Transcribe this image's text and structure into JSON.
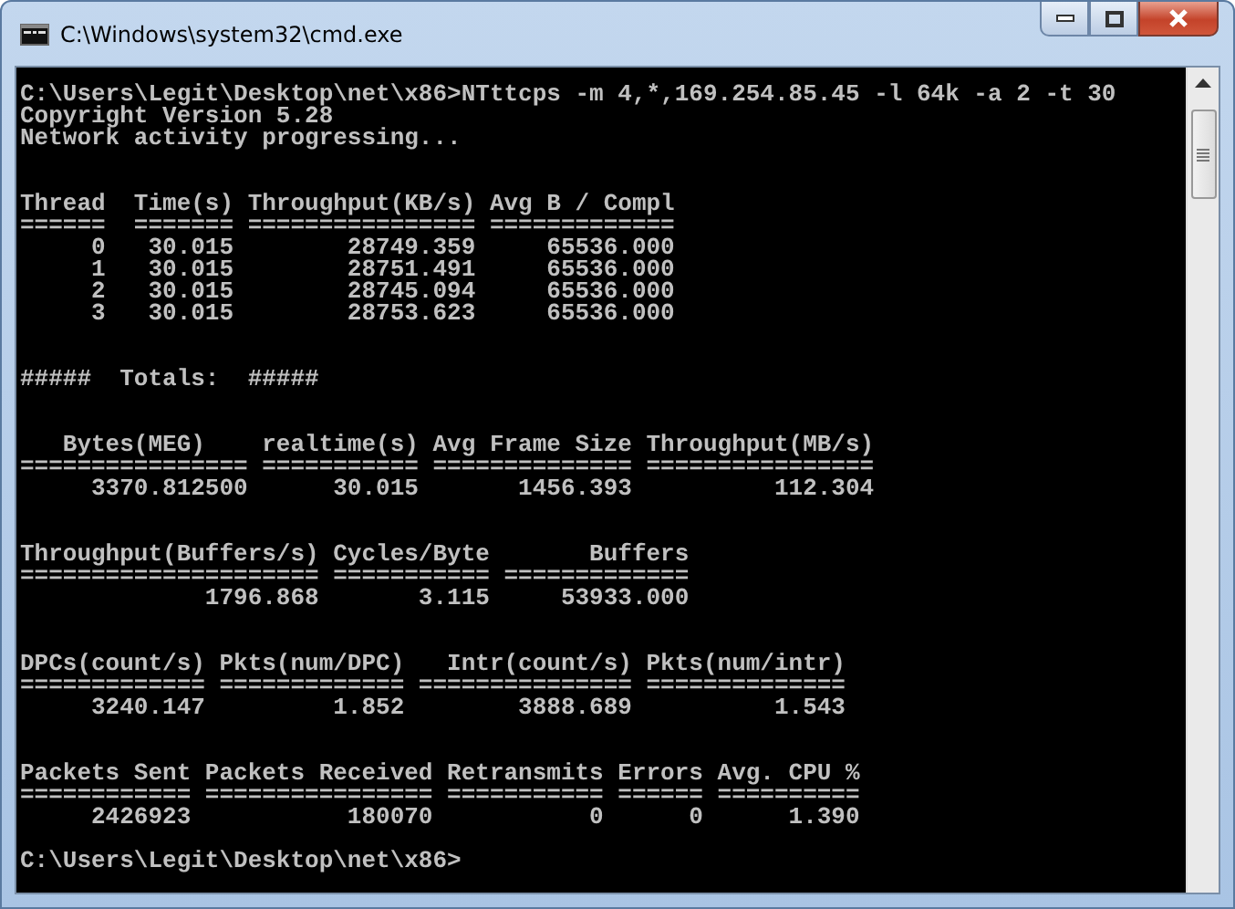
{
  "window": {
    "title": "C:\\Windows\\system32\\cmd.exe"
  },
  "console": {
    "blocks": [
      {
        "kind": "output",
        "lines": [
          "C:\\Users\\Legit\\Desktop\\net\\x86>NTttcps -m 4,*,169.254.85.45 -l 64k -a 2 -t 30",
          "Copyright Version 5.28",
          "Network activity progressing..."
        ]
      },
      {
        "kind": "output",
        "lines": [
          "Thread  Time(s) Throughput(KB/s) Avg B / Compl",
          "======  ======= ================ =============",
          "     0   30.015        28749.359     65536.000",
          "     1   30.015        28751.491     65536.000",
          "     2   30.015        28745.094     65536.000",
          "     3   30.015        28753.623     65536.000"
        ]
      },
      {
        "kind": "output",
        "lines": [
          "#####  Totals:  #####"
        ]
      },
      {
        "kind": "output",
        "lines": [
          "   Bytes(MEG)    realtime(s) Avg Frame Size Throughput(MB/s)",
          "================ =========== ============== ================",
          "     3370.812500      30.015       1456.393          112.304"
        ]
      },
      {
        "kind": "output",
        "lines": [
          "Throughput(Buffers/s) Cycles/Byte       Buffers",
          "===================== =========== =============",
          "             1796.868       3.115     53933.000"
        ]
      },
      {
        "kind": "output",
        "lines": [
          "DPCs(count/s) Pkts(num/DPC)   Intr(count/s) Pkts(num/intr)",
          "============= ============= =============== ==============",
          "     3240.147         1.852        3888.689          1.543"
        ]
      },
      {
        "kind": "output",
        "lines": [
          "Packets Sent Packets Received Retransmits Errors Avg. CPU %",
          "============ ================ =========== ====== ==========",
          "     2426923           180070           0      0      1.390"
        ]
      },
      {
        "kind": "prompt",
        "lines": [
          "C:\\Users\\Legit\\Desktop\\net\\x86>"
        ]
      }
    ]
  }
}
